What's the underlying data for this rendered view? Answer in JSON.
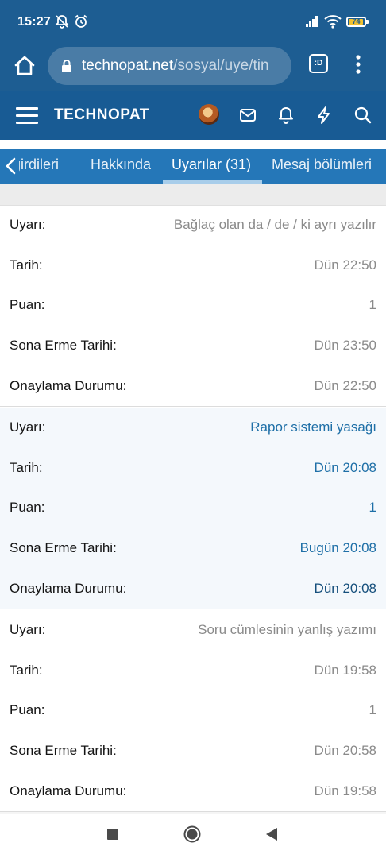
{
  "status_bar": {
    "time": "15:27",
    "battery": "74",
    "icons": [
      "mute-icon",
      "alarm-icon",
      "signal-icon",
      "wifi-icon",
      "battery-icon"
    ]
  },
  "browser": {
    "url_host": "technopat.net",
    "url_path": "/sosyal/uye/tin",
    "tabs_label": ":D"
  },
  "site": {
    "logo": "TECHNOPAT"
  },
  "tabs": [
    {
      "label": "girdileri"
    },
    {
      "label": "Hakkında"
    },
    {
      "label": "Uyarılar (31)",
      "active": true
    },
    {
      "label": "Mesaj bölümleri"
    }
  ],
  "warnings": [
    {
      "highlighted": false,
      "fields": [
        {
          "label": "Uyarı:",
          "value": "Bağlaç olan da / de / ki ayrı yazılır"
        },
        {
          "label": "Tarih:",
          "value": "Dün 22:50"
        },
        {
          "label": "Puan:",
          "value": "1"
        },
        {
          "label": "Sona Erme Tarihi:",
          "value": "Dün 23:50"
        },
        {
          "label": "Onaylama Durumu:",
          "value": "Dün 22:50"
        }
      ]
    },
    {
      "highlighted": true,
      "fields": [
        {
          "label": "Uyarı:",
          "value": "Rapor sistemi yasağı"
        },
        {
          "label": "Tarih:",
          "value": "Dün 20:08"
        },
        {
          "label": "Puan:",
          "value": "1"
        },
        {
          "label": "Sona Erme Tarihi:",
          "value": "Bugün 20:08"
        },
        {
          "label": "Onaylama Durumu:",
          "value": "Dün 20:08"
        }
      ]
    },
    {
      "highlighted": false,
      "fields": [
        {
          "label": "Uyarı:",
          "value": "Soru cümlesinin yanlış yazımı"
        },
        {
          "label": "Tarih:",
          "value": "Dün 19:58"
        },
        {
          "label": "Puan:",
          "value": "1"
        },
        {
          "label": "Sona Erme Tarihi:",
          "value": "Dün 20:58"
        },
        {
          "label": "Onaylama Durumu:",
          "value": "Dün 19:58"
        }
      ]
    }
  ],
  "colors": {
    "header_bg": "#185b94",
    "tab_bg": "#2577b8",
    "link_blue": "#1e6fa7"
  }
}
